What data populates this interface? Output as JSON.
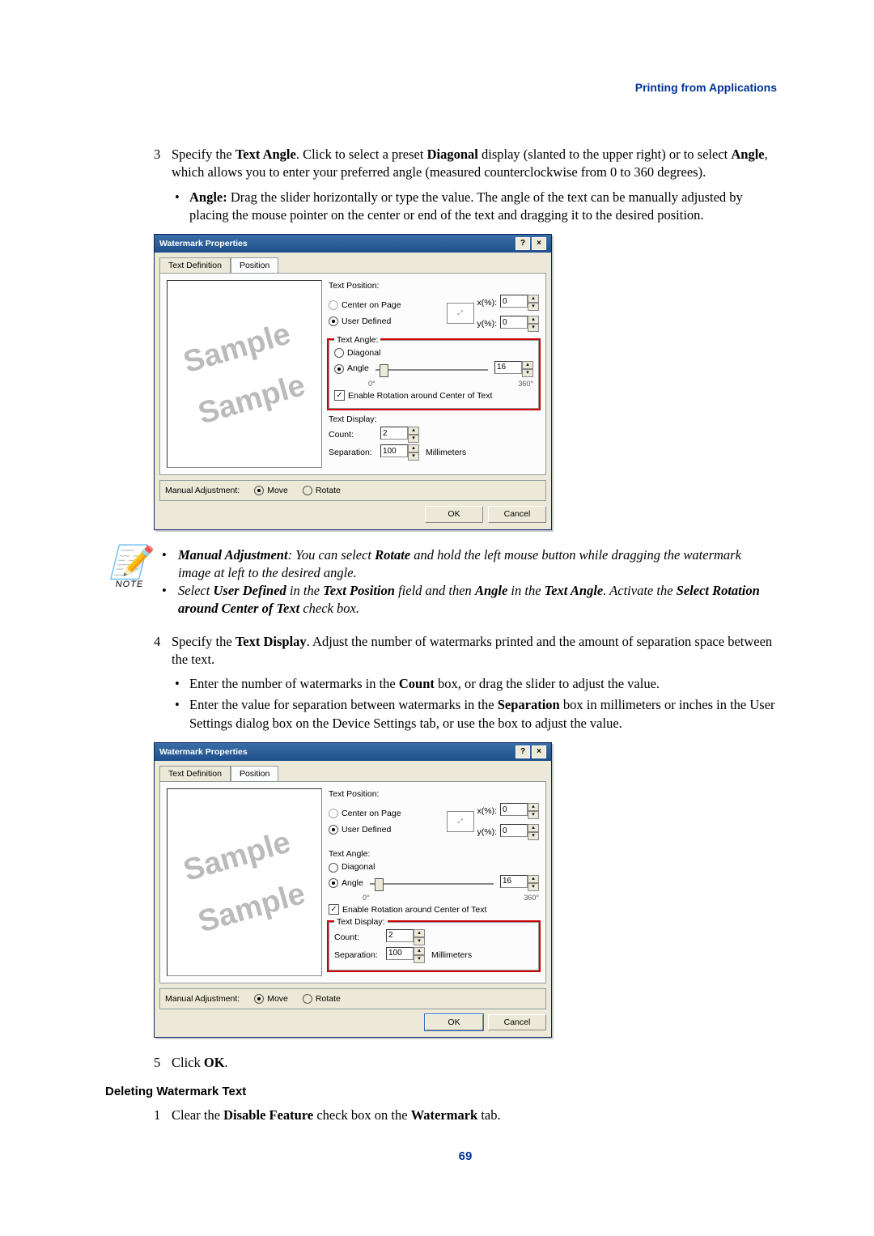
{
  "header_link": "Printing from Applications",
  "step3": {
    "num": "3",
    "before_bold1": "Specify the ",
    "bold1": "Text Angle",
    "mid1": ". Click to select a preset ",
    "bold2": "Diagonal",
    "mid2": " display (slanted to the upper right) or to select ",
    "bold3": "Angle",
    "after": ", which allows you to enter your preferred angle (measured counterclockwise from 0 to 360 degrees)."
  },
  "step3_bullet": {
    "bold": "Angle:",
    "text": " Drag the slider horizontally or type the value. The angle of the text can be manually adjusted by placing the mouse pointer on the center or end of the text and dragging it to the desired position."
  },
  "dialog": {
    "title": "Watermark Properties",
    "help": "?",
    "close": "×",
    "tab1": "Text Definition",
    "tab2": "Position",
    "preview_text": "Sample",
    "textpos": {
      "label": "Text Position:",
      "opt_center": "Center on Page",
      "opt_user": "User Defined",
      "x_lbl": "x(%):",
      "x_val": "0",
      "y_lbl": "y(%):",
      "y_val": "0"
    },
    "textangle": {
      "label": "Text Angle:",
      "opt_diag": "Diagonal",
      "opt_angle": "Angle",
      "angle_val": "16",
      "tick0": "0°",
      "tick360": "360°",
      "chk_enable": "Enable Rotation around Center of Text"
    },
    "textdisp": {
      "label": "Text Display:",
      "count_lbl": "Count:",
      "count_val": "2",
      "sep_lbl": "Separation:",
      "sep_val": "100",
      "sep_unit": "Millimeters"
    },
    "manual": {
      "label": "Manual Adjustment:",
      "move": "Move",
      "rotate": "Rotate"
    },
    "ok": "OK",
    "cancel": "Cancel"
  },
  "note": {
    "caption": "NOTE",
    "line1a": "Manual Adjustment",
    "line1b": ": You can select ",
    "line1c": "Rotate",
    "line1d": " and hold the left mouse button while dragging the watermark image at left to the desired angle.",
    "line2a": "Select ",
    "line2b": "User Defined",
    "line2c": " in the ",
    "line2d": "Text Position",
    "line2e": " field and then ",
    "line2f": "Angle",
    "line2g": " in the ",
    "line2h": "Text Angle",
    "line2i": ". Activate the ",
    "line2j": "Select Rotation around Center of Text",
    "line2k": " check box."
  },
  "step4": {
    "num": "4",
    "a1": "Specify the ",
    "b1": "Text Display",
    "a2": ". Adjust the number of watermarks printed and the amount of separation space between the text."
  },
  "step4_bul1": {
    "a": "Enter the number of watermarks in the ",
    "b": "Count",
    "c": " box, or drag the slider to adjust the value."
  },
  "step4_bul2": {
    "a": "Enter the value for separation between watermarks in the ",
    "b": "Separation",
    "c": " box in millimeters or inches in the User Settings dialog box on the Device Settings tab, or use the box to adjust the value."
  },
  "step5": {
    "num": "5",
    "a": "Click ",
    "b": "OK",
    "c": "."
  },
  "subhead": "Deleting Watermark Text",
  "del1": {
    "num": "1",
    "a": "Clear the ",
    "b": "Disable Feature",
    "c": " check box on the ",
    "d": "Watermark",
    "e": " tab."
  },
  "page_num": "69"
}
